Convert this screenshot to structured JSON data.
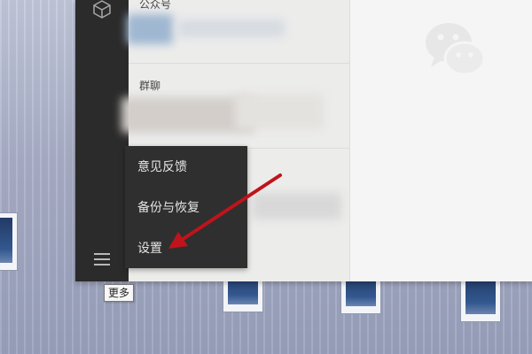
{
  "list": {
    "items": [
      {
        "label": "公众号"
      },
      {
        "label": "群聊"
      }
    ]
  },
  "popup_menu": {
    "items": [
      {
        "label": "意见反馈"
      },
      {
        "label": "备份与恢复"
      },
      {
        "label": "设置"
      }
    ]
  },
  "rail": {
    "menu_tooltip": "更多"
  },
  "colors": {
    "rail_bg": "#2b2b2b",
    "menu_bg": "#2f2f2f",
    "arrow": "#c0131b"
  },
  "icons": {
    "top": "cube-icon",
    "bottom": "hamburger-menu-icon",
    "chat_watermark": "wechat-logo-icon"
  }
}
